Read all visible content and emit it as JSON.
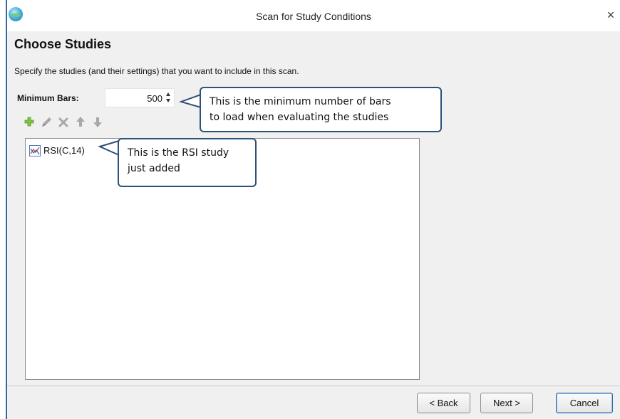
{
  "window": {
    "title": "Scan for Study Conditions",
    "close_glyph": "×"
  },
  "page": {
    "heading": "Choose Studies",
    "instruction": "Specify the studies (and their settings) that you want to include in this scan."
  },
  "min_bars": {
    "label": "Minimum Bars:",
    "value": "500"
  },
  "toolbar": {
    "icons": [
      "add-icon",
      "edit-icon",
      "remove-icon",
      "move-up-icon",
      "move-down-icon"
    ],
    "colors": {
      "add": "#7cc242",
      "disabled": "#a8a8a8"
    }
  },
  "studies": [
    {
      "label": "RSI(C,14)",
      "icon": "study-chart-icon"
    }
  ],
  "buttons": {
    "back": "< Back",
    "next": "Next >",
    "cancel": "Cancel"
  },
  "callouts": {
    "min_bars_line1": "This is the minimum number of bars",
    "min_bars_line2": "to load when evaluating the studies",
    "study_line1": "This is the RSI study",
    "study_line2": "just added"
  },
  "colors": {
    "window_bg": "#f0f0f0",
    "accent": "#2e6aa6",
    "callout_border": "#2e5277"
  }
}
